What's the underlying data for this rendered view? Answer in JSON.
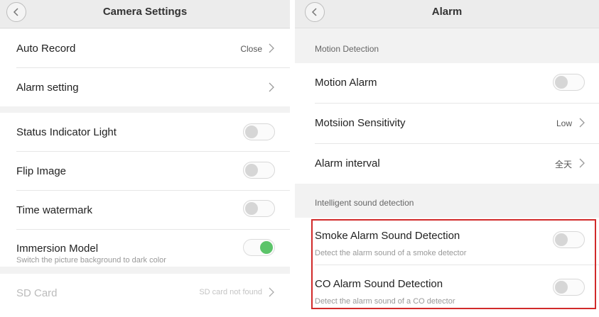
{
  "left": {
    "title": "Camera Settings",
    "auto_record": {
      "label": "Auto Record",
      "value": "Close"
    },
    "alarm_setting": {
      "label": "Alarm setting"
    },
    "status_indicator": {
      "label": "Status Indicator Light",
      "on": false
    },
    "flip_image": {
      "label": "Flip Image",
      "on": false
    },
    "time_watermark": {
      "label": "Time watermark",
      "on": false
    },
    "immersion": {
      "label": "Immersion Model",
      "description": "Switch the picture background to dark color",
      "on": true
    },
    "sd_card": {
      "label": "SD Card",
      "value": "SD card not found"
    }
  },
  "right": {
    "title": "Alarm",
    "motion_section": "Motion Detection",
    "motion_alarm": {
      "label": "Motion Alarm",
      "on": false
    },
    "sensitivity": {
      "label": "Motsiion Sensitivity",
      "value": "Low"
    },
    "interval": {
      "label": "Alarm interval",
      "value": "全天"
    },
    "sound_section": "Intelligent sound detection",
    "smoke": {
      "label": "Smoke Alarm Sound Detection",
      "description": "Detect the alarm sound of a smoke detector",
      "on": false
    },
    "co": {
      "label": "CO Alarm Sound Detection",
      "description": "Detect the alarm sound of a CO detector",
      "on": false
    }
  },
  "colors": {
    "toggle_on": "#5cc46a",
    "highlight_border": "#d12a2a"
  },
  "icons": {
    "back": "chevron-left-icon",
    "forward": "chevron-right-icon"
  }
}
